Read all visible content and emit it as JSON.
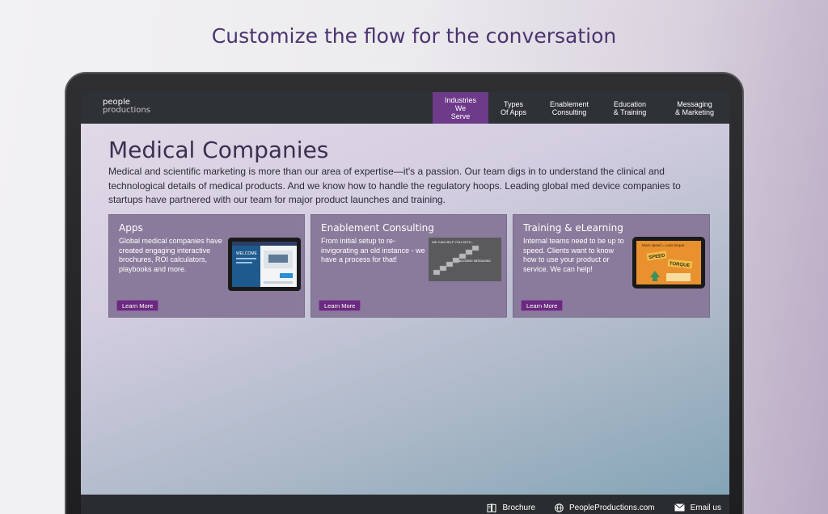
{
  "headline": "Customize the flow for the conversation",
  "logo": {
    "line1": "people",
    "line2": "productions"
  },
  "nav": [
    {
      "label": "Industries\nWe Serve",
      "active": true
    },
    {
      "label": "Types\nOf Apps",
      "active": false
    },
    {
      "label": "Enablement\nConsulting",
      "active": false
    },
    {
      "label": "Education\n& Training",
      "active": false
    },
    {
      "label": "Messaging\n& Marketing",
      "active": false
    }
  ],
  "page": {
    "title": "Medical Companies",
    "description": "Medical and scientific marketing is more than our area of expertise—it's a passion. Our team digs in to understand the clinical and technological details of medical products. And we know how to handle the regulatory hoops. Leading global med device companies to startups have partnered with our team for major product launches and training."
  },
  "cards": [
    {
      "title": "Apps",
      "text": "Global medical companies have created engaging interactive brochures, ROI calculators, playbooks and more.",
      "button": "Learn More"
    },
    {
      "title": "Enablement Consulting",
      "text": "From initial setup to re-invigorating an old instance - we have a process for that!",
      "button": "Learn More"
    },
    {
      "title": "Training & eLearning",
      "text": "Internal teams need to be up to speed. Clients want to know how to use your product or service. We can help!",
      "button": "Learn More"
    }
  ],
  "thumbs": {
    "apps_screen_text": "WELCOME",
    "consult_header": "WE CAN HELP YOU WITH...",
    "consult_label": "ALIGNING MESSAGING",
    "training_top": "More speed = Less torque",
    "training_word1": "SPEED",
    "training_word2": "TORQUE"
  },
  "footer": [
    {
      "label": "Brochure",
      "icon": "book-icon"
    },
    {
      "label": "PeopleProductions.com",
      "icon": "globe-icon"
    },
    {
      "label": "Email us",
      "icon": "envelope-icon"
    }
  ],
  "colors": {
    "accent": "#6e3b8a",
    "nav_bg": "#2e3236",
    "card_bg": "#8a7b9c",
    "headline": "#4b3470"
  }
}
